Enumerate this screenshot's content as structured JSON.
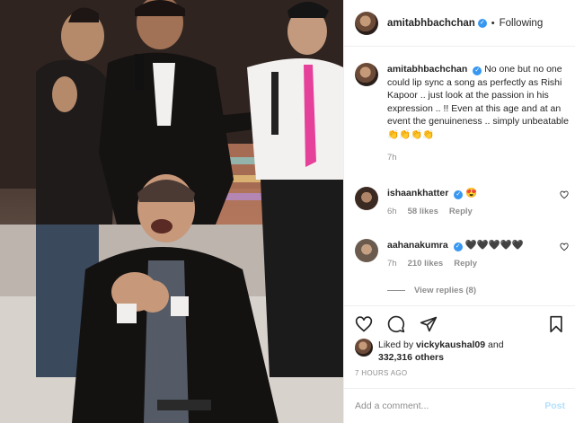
{
  "post": {
    "author": "amitabhbachchan",
    "follow_status": "Following",
    "header_separator": "•",
    "caption": {
      "username": "amitabhbachchan",
      "text": "No one but no one could lip sync a song as perfectly as Rishi Kapoor .. just look at the passion in his expression .. !! Even at this age and at an event the genuineness .. simply unbeatable 👏👏👏👏",
      "time": "7h"
    },
    "comments": [
      {
        "username": "ishaankhatter",
        "text": "😍",
        "time": "6h",
        "likes": "58 likes",
        "reply": "Reply"
      },
      {
        "username": "aahanakumra",
        "text": "🖤🖤🖤🖤🖤",
        "time": "7h",
        "likes": "210 likes",
        "reply": "Reply"
      }
    ],
    "view_replies": "View replies (8)",
    "likes": {
      "prefix": "Liked by",
      "user": "vickykaushal09",
      "and": "and",
      "others": "332,316 others"
    },
    "posted_ago": "7 HOURS AGO",
    "add_comment": {
      "placeholder": "Add a comment...",
      "post_label": "Post"
    }
  },
  "icons": {
    "verified": "verified-badge-icon",
    "like": "heart-icon",
    "comment": "comment-bubble-icon",
    "share": "paper-plane-icon",
    "save": "bookmark-icon"
  },
  "colors": {
    "verified": "#3897f0",
    "muted": "#8e8e8e",
    "post_disabled": "#b2dffc",
    "text": "#262626"
  }
}
